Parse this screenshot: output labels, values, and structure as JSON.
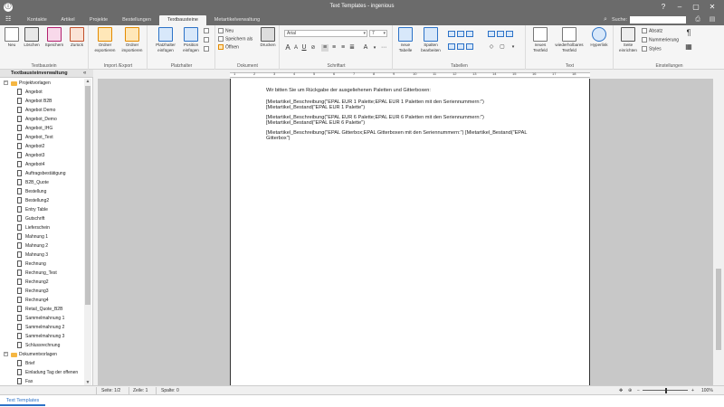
{
  "window": {
    "title": "Text Templates - ingenious",
    "logo": "ⓘ",
    "controls": [
      "?",
      "–",
      "▢",
      "✕"
    ]
  },
  "tabs": [
    {
      "label": "Kontakte",
      "active": false
    },
    {
      "label": "Artikel",
      "active": false
    },
    {
      "label": "Projekte",
      "active": false
    },
    {
      "label": "Bestellungen",
      "active": false
    },
    {
      "label": "Textbausteine",
      "active": true
    },
    {
      "label": "Metartikelverwaltung",
      "active": false
    }
  ],
  "search": {
    "label": "Suche:",
    "value": ""
  },
  "ribbon": {
    "textbaustein": {
      "label": "Textbaustein",
      "buttons": [
        "Neu",
        "Löschen",
        "Speichern",
        "Zurück"
      ]
    },
    "import_export": {
      "label": "Import /Export",
      "buttons": [
        "Ordner exportieren",
        "Ordner importieren"
      ]
    },
    "platzhalter": {
      "label": "Platzhalter",
      "buttons": [
        "Platzhalter einfügen",
        "Position einfügen"
      ]
    },
    "dokument": {
      "label": "Dokument",
      "small": [
        "Neu",
        "Speichern als",
        "Öffnen"
      ],
      "print": "Drucken"
    },
    "schriftart": {
      "label": "Schriftart",
      "font": "Arial",
      "size": "7"
    },
    "tabellen": {
      "label": "Tabellen",
      "buttons": [
        "neue Tabelle",
        "Spalten bearbeiten"
      ]
    },
    "text": {
      "label": "Text",
      "buttons": [
        "neues Textfeld",
        "wiederholbares Textfeld",
        "Hyperlink"
      ]
    },
    "einstellungen": {
      "label": "Einstellungen",
      "buttons": [
        "Seite einrichten"
      ],
      "small": [
        "Absatz",
        "Nummerierung",
        "Styles"
      ]
    }
  },
  "ruler": {
    "numbers": [
      "1",
      "2",
      "3",
      "4",
      "5",
      "6",
      "7",
      "8",
      "9",
      "10",
      "11",
      "12",
      "13",
      "14",
      "15",
      "16",
      "17",
      "18"
    ]
  },
  "left_panel": {
    "title": "Textbausteinverwaltung",
    "collapse": "«",
    "tree": [
      {
        "type": "folder",
        "label": "Projektvorlagen",
        "level": 0,
        "expand": "−"
      },
      {
        "type": "file",
        "label": "Angebot",
        "level": 1
      },
      {
        "type": "file",
        "label": "Angebot B2B",
        "level": 1
      },
      {
        "type": "file",
        "label": "Angebot Demo",
        "level": 1
      },
      {
        "type": "file",
        "label": "Angebot_Demo",
        "level": 1
      },
      {
        "type": "file",
        "label": "Angebot_IHG",
        "level": 1
      },
      {
        "type": "file",
        "label": "Angebot_Text",
        "level": 1
      },
      {
        "type": "file",
        "label": "Angebot2",
        "level": 1
      },
      {
        "type": "file",
        "label": "Angebot3",
        "level": 1
      },
      {
        "type": "file",
        "label": "Angebot4",
        "level": 1
      },
      {
        "type": "file",
        "label": "Auftragsbestätigung",
        "level": 1
      },
      {
        "type": "file",
        "label": "B2B_Quote",
        "level": 1
      },
      {
        "type": "file",
        "label": "Bestellung",
        "level": 1
      },
      {
        "type": "file",
        "label": "Bestellung2",
        "level": 1
      },
      {
        "type": "file",
        "label": "Entry Table",
        "level": 1
      },
      {
        "type": "file",
        "label": "Gutschrift",
        "level": 1
      },
      {
        "type": "file",
        "label": "Lieferschein",
        "level": 1
      },
      {
        "type": "file",
        "label": "Mahnung 1",
        "level": 1
      },
      {
        "type": "file",
        "label": "Mahnung 2",
        "level": 1
      },
      {
        "type": "file",
        "label": "Mahnung 3",
        "level": 1
      },
      {
        "type": "file",
        "label": "Rechnung",
        "level": 1
      },
      {
        "type": "file",
        "label": "Rechnung_Test",
        "level": 1
      },
      {
        "type": "file",
        "label": "Rechnung2",
        "level": 1
      },
      {
        "type": "file",
        "label": "Rechnung3",
        "level": 1
      },
      {
        "type": "file",
        "label": "Rechnung4",
        "level": 1
      },
      {
        "type": "file",
        "label": "Retail_Quote_B2B",
        "level": 1
      },
      {
        "type": "file",
        "label": "Sammelmahnung 1",
        "level": 1
      },
      {
        "type": "file",
        "label": "Sammelmahnung 2",
        "level": 1
      },
      {
        "type": "file",
        "label": "Sammelmahnung 3",
        "level": 1
      },
      {
        "type": "file",
        "label": "Schlussrechnung",
        "level": 1
      },
      {
        "type": "folder",
        "label": "Dokumentvorlagen",
        "level": 0,
        "expand": "−"
      },
      {
        "type": "file",
        "label": "Brief",
        "level": 1
      },
      {
        "type": "file",
        "label": "Einladung Tag der offenen",
        "level": 1
      },
      {
        "type": "file",
        "label": "Fax",
        "level": 1
      }
    ]
  },
  "document": {
    "lines": [
      "Wir bitten Sie um Rückgabe der ausgeliehenen Paletten und Gitterboxen:",
      "[Mietartikel_Beschreibung(\"EPAL EUR 1 Palette;EPAL EUR 1 Paletten mit den Seriennummern:\")",
      "[Mietartikel_Bestand(\"EPAL EUR 1 Palette\")",
      "[Mietartikel_Beschreibung(\"EPAL EUR 6 Palette;EPAL EUR 6 Paletten mit den Seriennummern:\")",
      "[Mietartikel_Bestand(\"EPAL EUR 6 Palette\")",
      "[Mietartikel_Beschreibung(\"EPAL Gitterbox;EPAL Gitterboxen mit den Seriennummern:\") [Mietartikel_Bestand(\"EPAL",
      "Gitterbox\")"
    ]
  },
  "status": {
    "seite": "Seite: 1/2",
    "zeile": "Zeile: 1",
    "spalte": "Spalte: 0",
    "zoom": "100%",
    "zoom_level": 0.5
  },
  "bottom_tabs": [
    "Text Templates"
  ],
  "colors": {
    "titlebar": "#6b6b6b",
    "accent": "#2c72c7",
    "folder": "#f5b642",
    "page_bg": "#c8c8c8"
  }
}
